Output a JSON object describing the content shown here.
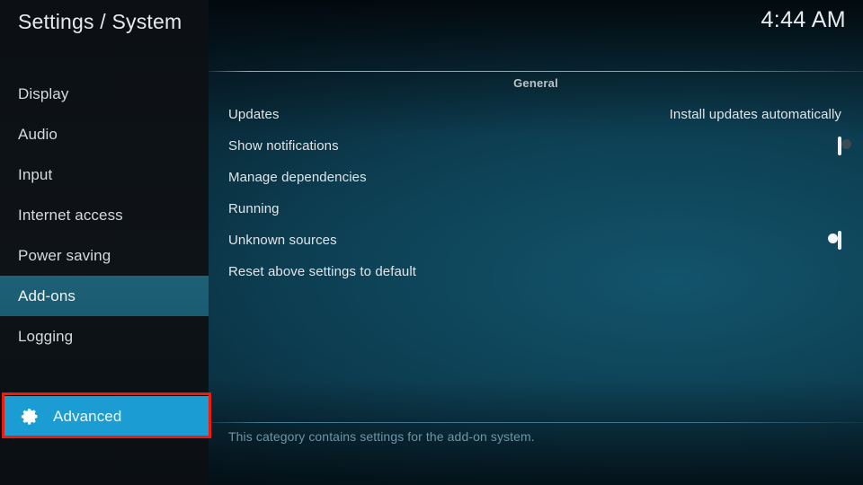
{
  "header": {
    "title": "Settings / System",
    "clock": "4:44 AM"
  },
  "sidebar": {
    "items": [
      {
        "label": "Display",
        "selected": false
      },
      {
        "label": "Audio",
        "selected": false
      },
      {
        "label": "Input",
        "selected": false
      },
      {
        "label": "Internet access",
        "selected": false
      },
      {
        "label": "Power saving",
        "selected": false
      },
      {
        "label": "Add-ons",
        "selected": true
      },
      {
        "label": "Logging",
        "selected": false
      }
    ],
    "focused_item": {
      "label": "Advanced",
      "icon": "gear-icon",
      "highlight_color": "#1b9dd4",
      "annotation_color": "#f21a0c"
    }
  },
  "main": {
    "section_header": "General",
    "rows": [
      {
        "label": "Updates",
        "type": "value",
        "value": "Install updates automatically"
      },
      {
        "label": "Show notifications",
        "type": "toggle",
        "value": "off"
      },
      {
        "label": "Manage dependencies",
        "type": "plain",
        "value": ""
      },
      {
        "label": "Running",
        "type": "plain",
        "value": ""
      },
      {
        "label": "Unknown sources",
        "type": "toggle",
        "value": "on"
      },
      {
        "label": "Reset above settings to default",
        "type": "plain",
        "value": ""
      }
    ],
    "footer_description": "This category contains settings for the add-on system."
  }
}
